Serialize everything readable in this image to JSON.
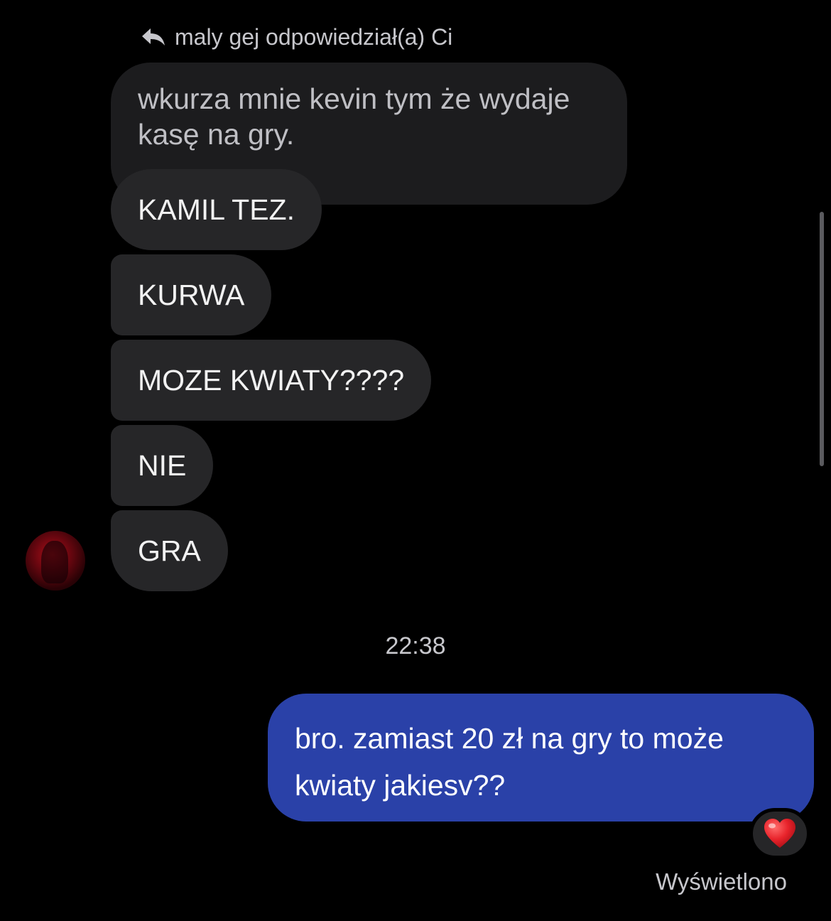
{
  "reply_header": {
    "text": "maly gej odpowiedział(a) Ci"
  },
  "quoted_message": {
    "text": "wkurza mnie kevin tym że wydaje kasę na gry."
  },
  "incoming_messages": [
    {
      "text": "KAMIL TEZ."
    },
    {
      "text": "KURWA"
    },
    {
      "text": "MOZE KWIATY????"
    },
    {
      "text": "NIE"
    },
    {
      "text": "GRA"
    }
  ],
  "timestamp": "22:38",
  "outgoing_message": {
    "text": "bro. zamiast 20 zł na gry to może kwiaty jakiesv??",
    "reaction": "heart-emoji",
    "color": "#2a41a8"
  },
  "status": "Wyświetlono",
  "colors": {
    "background": "#000000",
    "incoming_bubble": "#262628",
    "quoted_bubble": "#1c1c1e",
    "reaction_heart": "#e8232b"
  }
}
